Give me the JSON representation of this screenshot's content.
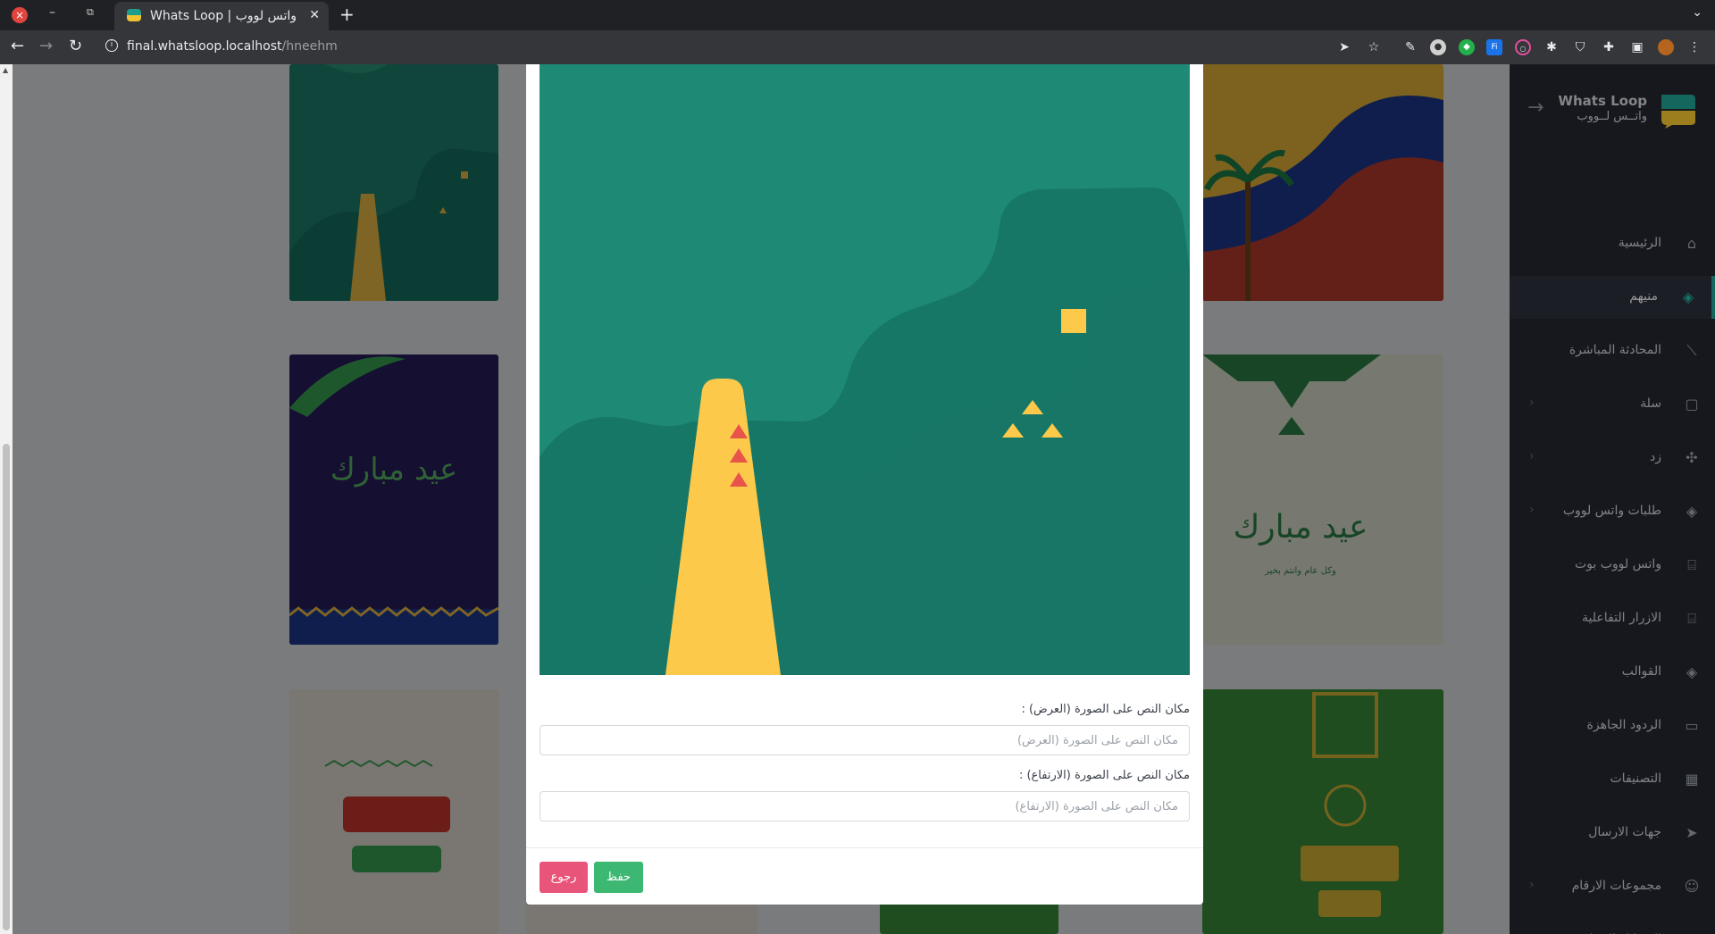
{
  "browser": {
    "tab_title": "Whats Loop | واتس لووب",
    "url_host": "final.whatsloop.localhost",
    "url_path": "/hneehm",
    "new_tab_glyph": "+",
    "tab_close_glyph": "✕"
  },
  "sidebar": {
    "brand_name": "Whats Loop",
    "brand_sub": "واتــس لــووب",
    "items": [
      {
        "label": "الرئيسية",
        "icon": "home-icon",
        "glyph": "⌂",
        "active": false,
        "has_chevron": false
      },
      {
        "label": "منيهم",
        "icon": "layers-icon",
        "glyph": "◈",
        "active": true,
        "has_chevron": false
      },
      {
        "label": "المحادثة المباشرة",
        "icon": "chart-icon",
        "glyph": "⟋",
        "active": false,
        "has_chevron": false
      },
      {
        "label": "سلة",
        "icon": "basket-icon",
        "glyph": "▢",
        "active": false,
        "has_chevron": true
      },
      {
        "label": "زد",
        "icon": "nodes-icon",
        "glyph": "✣",
        "active": false,
        "has_chevron": true
      },
      {
        "label": "طلبات واتس لووب",
        "icon": "layers-icon",
        "glyph": "◈",
        "active": false,
        "has_chevron": true
      },
      {
        "label": "واتس لووب بوت",
        "icon": "bot-icon",
        "glyph": "⌸",
        "active": false,
        "has_chevron": false
      },
      {
        "label": "الازرار التفاعلية",
        "icon": "bot-icon",
        "glyph": "⌸",
        "active": false,
        "has_chevron": false
      },
      {
        "label": "القوالب",
        "icon": "layers-icon",
        "glyph": "◈",
        "active": false,
        "has_chevron": false
      },
      {
        "label": "الردود الجاهزة",
        "icon": "chat-icon",
        "glyph": "▭",
        "active": false,
        "has_chevron": false
      },
      {
        "label": "التصنيفات",
        "icon": "grid-icon",
        "glyph": "▦",
        "active": false,
        "has_chevron": false
      },
      {
        "label": "جهات الارسال",
        "icon": "send-icon",
        "glyph": "➤",
        "active": false,
        "has_chevron": false
      },
      {
        "label": "مجموعات الارقام",
        "icon": "users-add-icon",
        "glyph": "☺",
        "active": false,
        "has_chevron": true
      },
      {
        "label": "الرسائل الجماعية",
        "icon": "edit-icon",
        "glyph": "✎",
        "active": false,
        "has_chevron": true
      }
    ]
  },
  "cards": {
    "eid_text_1": "عيد مبارك",
    "eid_text_2": "عيد مبارك",
    "eid_sub": "وكل عام وانتم بخير"
  },
  "modal": {
    "width_label": "مكان النص على الصورة (العرض) :",
    "width_placeholder": "مكان النص على الصورة (العرض)",
    "height_label": "مكان النص على الصورة (الارتفاع) :",
    "height_placeholder": "مكان النص على الصورة (الارتفاع)",
    "save_label": "حفظ",
    "back_label": "رجوع"
  },
  "colors": {
    "accent_green": "#3cb872",
    "accent_pink": "#e9547a",
    "teal": "#1f8a76",
    "yellow": "#fcc94a"
  }
}
